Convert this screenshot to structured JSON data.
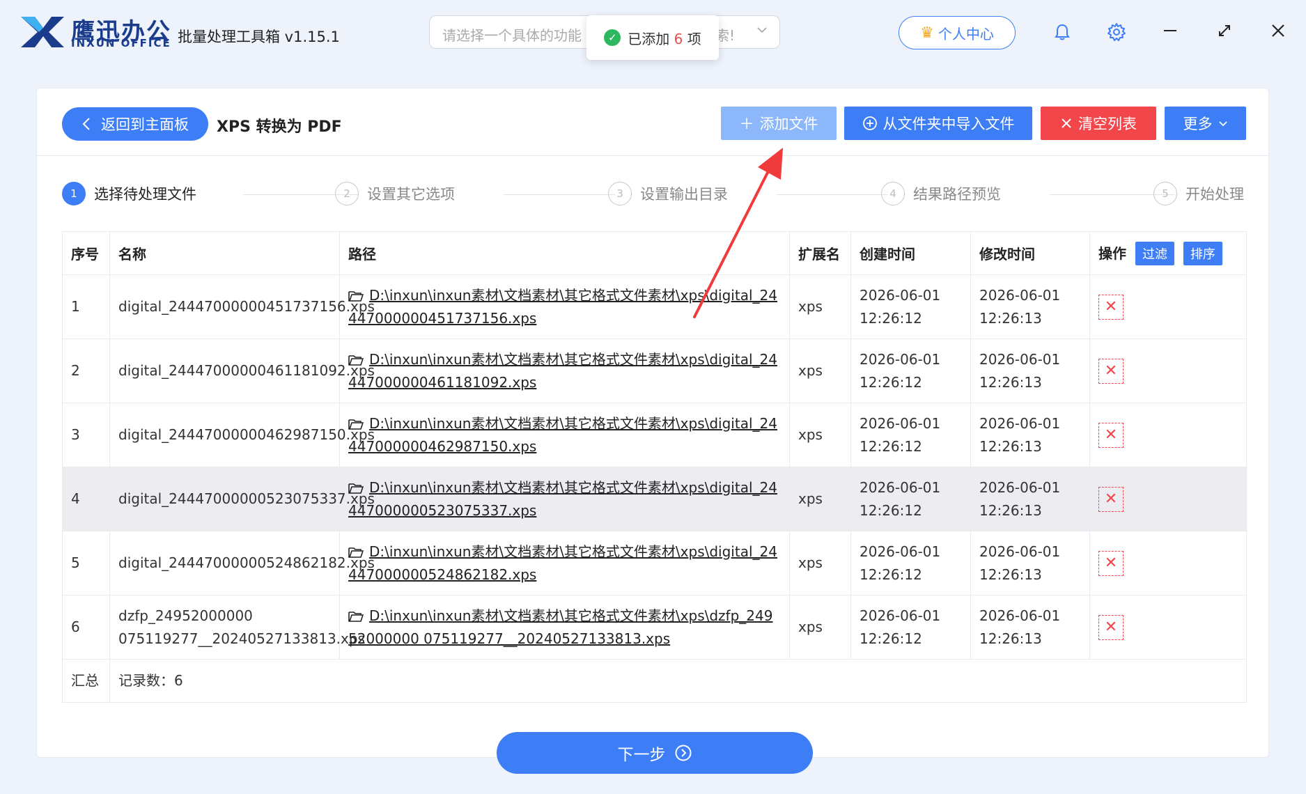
{
  "app": {
    "logo_cn": "鹰迅办公",
    "logo_en": "INXUN OFFICE",
    "title": "批量处理工具箱 v1.15.1"
  },
  "search": {
    "placeholder": "请选择一个具体的功能",
    "placeholder_tail": "索!"
  },
  "toast": {
    "prefix": "已添加",
    "count": "6",
    "suffix": "项"
  },
  "header": {
    "user_center": "个人中心"
  },
  "toolbar": {
    "back_label": "返回到主面板",
    "page_title": "XPS 转换为 PDF",
    "add_file": "添加文件",
    "import_folder": "从文件夹中导入文件",
    "clear_list": "清空列表",
    "more": "更多"
  },
  "steps": [
    {
      "num": "1",
      "label": "选择待处理文件",
      "active": true
    },
    {
      "num": "2",
      "label": "设置其它选项",
      "active": false
    },
    {
      "num": "3",
      "label": "设置输出目录",
      "active": false
    },
    {
      "num": "4",
      "label": "结果路径预览",
      "active": false
    },
    {
      "num": "5",
      "label": "开始处理",
      "active": false
    }
  ],
  "table": {
    "headers": {
      "index": "序号",
      "name": "名称",
      "path": "路径",
      "ext": "扩展名",
      "created": "创建时间",
      "modified": "修改时间",
      "action": "操作",
      "filter": "过滤",
      "sort": "排序"
    },
    "rows": [
      {
        "index": "1",
        "name": "digital_24447000000451737156.xps",
        "path": "D:\\inxun\\inxun素材\\文档素材\\其它格式文件素材\\xps\\digital_24447000000451737156.xps",
        "ext": "xps",
        "created": "2026-06-01 12:26:12",
        "modified": "2026-06-01 12:26:13"
      },
      {
        "index": "2",
        "name": "digital_24447000000461181092.xps",
        "path": "D:\\inxun\\inxun素材\\文档素材\\其它格式文件素材\\xps\\digital_24447000000461181092.xps",
        "ext": "xps",
        "created": "2026-06-01 12:26:12",
        "modified": "2026-06-01 12:26:13"
      },
      {
        "index": "3",
        "name": "digital_24447000000462987150.xps",
        "path": "D:\\inxun\\inxun素材\\文档素材\\其它格式文件素材\\xps\\digital_24447000000462987150.xps",
        "ext": "xps",
        "created": "2026-06-01 12:26:12",
        "modified": "2026-06-01 12:26:13"
      },
      {
        "index": "4",
        "name": "digital_24447000000523075337.xps",
        "path": "D:\\inxun\\inxun素材\\文档素材\\其它格式文件素材\\xps\\digital_24447000000523075337.xps",
        "ext": "xps",
        "created": "2026-06-01 12:26:12",
        "modified": "2026-06-01 12:26:13"
      },
      {
        "index": "5",
        "name": "digital_24447000000524862182.xps",
        "path": "D:\\inxun\\inxun素材\\文档素材\\其它格式文件素材\\xps\\digital_24447000000524862182.xps",
        "ext": "xps",
        "created": "2026-06-01 12:26:12",
        "modified": "2026-06-01 12:26:13"
      },
      {
        "index": "6",
        "name": "dzfp_24952000000 075119277__20240527133813.xps",
        "path": "D:\\inxun\\inxun素材\\文档素材\\其它格式文件素材\\xps\\dzfp_24952000000 075119277__20240527133813.xps",
        "ext": "xps",
        "created": "2026-06-01 12:26:12",
        "modified": "2026-06-01 12:26:13"
      }
    ],
    "summary": {
      "label": "汇总",
      "count_text": "记录数：6"
    }
  },
  "next_button": "下一步",
  "colors": {
    "primary": "#3d7ef6",
    "danger": "#f2464a",
    "success": "#2db85f",
    "annotation": "#ef3b3b"
  }
}
